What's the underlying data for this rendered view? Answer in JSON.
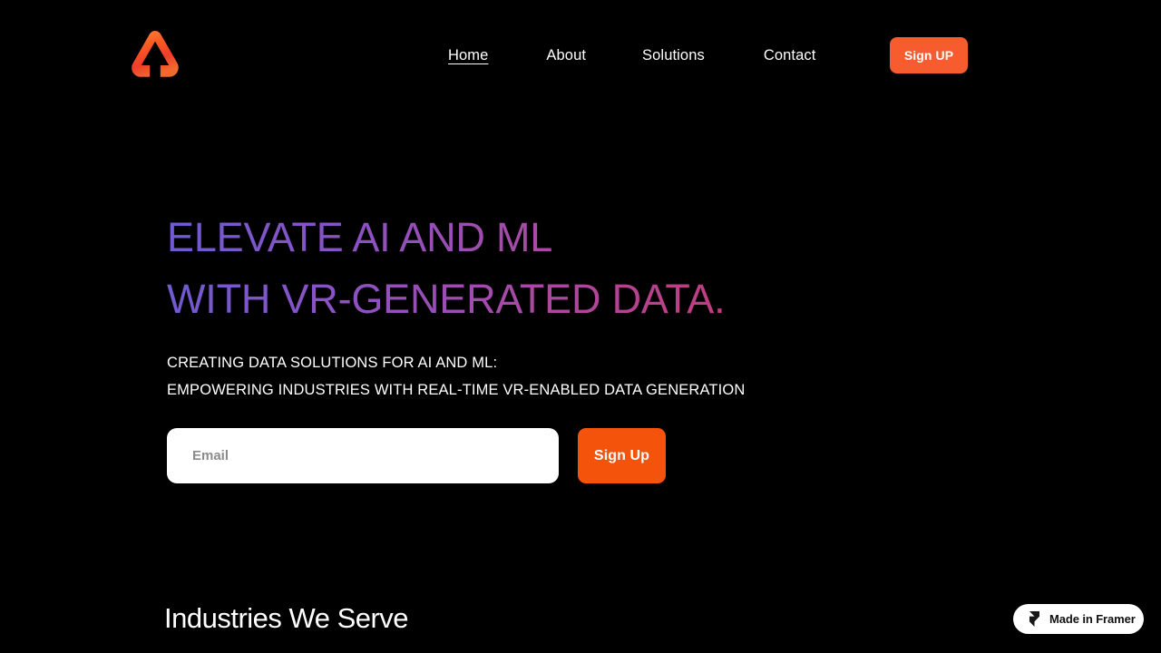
{
  "theme": {
    "background": "#000000",
    "accent_orange": "#f4530c",
    "nav_button_orange": "#f75c2f",
    "headline_gradient_start": "#6f5bd0",
    "headline_gradient_end": "#d42a58",
    "text_primary": "#ffffff"
  },
  "header": {
    "logo_icon": "triangle-arrow-logo",
    "nav": [
      {
        "label": "Home",
        "active": true
      },
      {
        "label": "About",
        "active": false
      },
      {
        "label": "Solutions",
        "active": false
      },
      {
        "label": "Contact",
        "active": false
      }
    ],
    "signup_button": "Sign UP"
  },
  "hero": {
    "headline_line1": "ELEVATE AI AND ML",
    "headline_line2": "WITH VR-GENERATED DATA.",
    "subcopy_line1": "CREATING DATA SOLUTIONS FOR AI AND ML:",
    "subcopy_line2": "EMPOWERING INDUSTRIES WITH REAL-TIME VR-ENABLED DATA GENERATION",
    "form": {
      "email_placeholder": "Email",
      "email_value": "",
      "submit_label": "Sign Up"
    }
  },
  "sections": {
    "industries_heading": "Industries We Serve"
  },
  "badge": {
    "icon": "framer-logo-icon",
    "label": "Made in Framer"
  }
}
